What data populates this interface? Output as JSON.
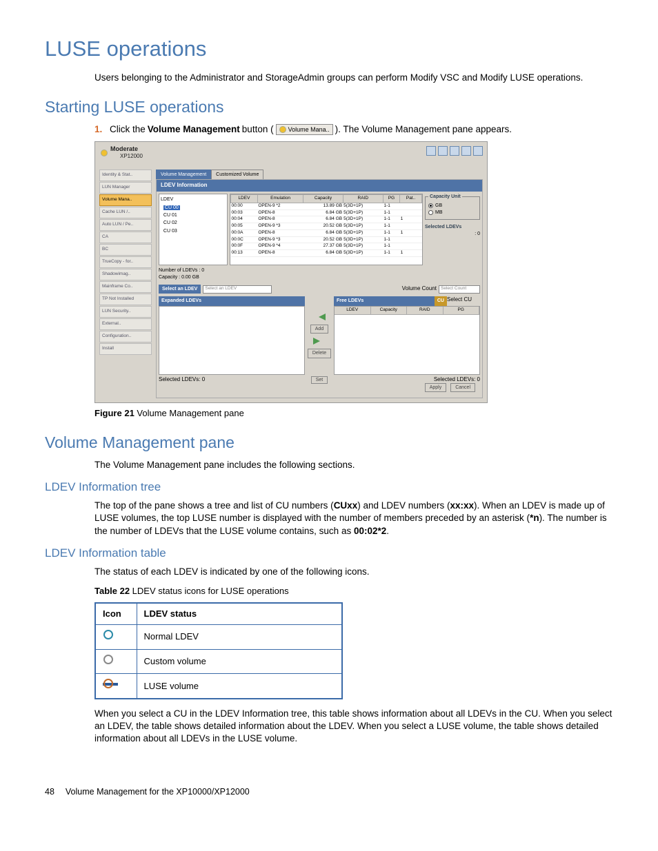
{
  "headings": {
    "h1": "LUSE operations",
    "h2_start": "Starting LUSE operations",
    "h2_vmp": "Volume Management pane",
    "h3_tree": "LDEV Information tree",
    "h3_table": "LDEV Information table"
  },
  "paras": {
    "intro": "Users belonging to the Administrator and StorageAdmin groups can perform Modify VSC and Modify LUSE operations.",
    "vmp_intro": "The Volume Management pane includes the following sections.",
    "tree_p_a": "The top of the pane shows a tree and list of CU numbers (",
    "tree_p_b": ") and LDEV numbers (",
    "tree_p_c": "). When an LDEV is made up of LUSE volumes, the top LUSE number is displayed with the number of members preceded by an asterisk (",
    "tree_p_d": "). The number is the number of LDEVs that the LUSE volume contains, such as ",
    "tree_bold_cu": "CUxx",
    "tree_bold_ldev": "xx:xx",
    "tree_bold_n": "*n",
    "tree_bold_ex": "00:02*2",
    "table_p": "The status of each LDEV is indicated by one of the following icons.",
    "cu_select": "When you select a CU in the LDEV Information tree, this table shows information about all LDEVs in the CU. When you select an LDEV, the table shows detailed information about the LDEV. When you select a LUSE volume, the table shows detailed information about all LDEVs in the LUSE volume."
  },
  "step1": {
    "num": "1.",
    "a": "Click the ",
    "b": "Volume Management",
    "c": " button ( ",
    "btn": "Volume Mana..",
    "d": " ). The Volume Management pane appears."
  },
  "fig21": {
    "label": "Figure 21",
    "text": " Volume Management pane"
  },
  "tbl22": {
    "label": "Table 22",
    "text": "   LDEV status icons for LUSE operations"
  },
  "status_table": {
    "h_icon": "Icon",
    "h_status": "LDEV status",
    "rows": [
      {
        "status": "Normal LDEV"
      },
      {
        "status": "Custom volume"
      },
      {
        "status": "LUSE volume"
      }
    ]
  },
  "footer": {
    "page": "48",
    "title": "Volume Management for the XP10000/XP12000"
  },
  "screenshot": {
    "moderate": "Moderate",
    "model": "XP12000",
    "tabs": {
      "vm": "Volume Management",
      "cv": "Customized Volume"
    },
    "banner": "LDEV Information",
    "sidebar": [
      "Identity & Stat..",
      "LUN Manager",
      "Volume Mana..",
      "Cache LUN /..",
      "Auto LUN / Pe..",
      "CA",
      "BC",
      "TrueCopy - for..",
      "Shadowimag..",
      "Mainframe Co..",
      "TP Not Installed",
      "LUN Security..",
      "External..",
      "Configuration..",
      "Install"
    ],
    "tree": {
      "root": "LDEV",
      "sel": "CU 00",
      "items": [
        "CU 01",
        "CU 02",
        "CU 03"
      ]
    },
    "table": {
      "headers": [
        "LDEV",
        "Emulation",
        "Capacity",
        "RAID",
        "PG",
        "Pat.."
      ],
      "rows": [
        [
          "00:00",
          "OPEN-9 *2",
          "13.89 GB",
          "5(3D+1P)",
          "1-1",
          ""
        ],
        [
          "00:03",
          "OPEN-8",
          "6.84 GB",
          "5(3D+1P)",
          "1-1",
          ""
        ],
        [
          "00:04",
          "OPEN-8",
          "6.84 GB",
          "5(3D+1P)",
          "1-1",
          "1"
        ],
        [
          "00:05",
          "OPEN-9 *3",
          "20.52 GB",
          "5(3D+1P)",
          "1-1",
          ""
        ],
        [
          "00:0A",
          "OPEN-8",
          "6.84 GB",
          "5(3D+1P)",
          "1-1",
          "1"
        ],
        [
          "00:0C",
          "OPEN-9 *3",
          "20.52 GB",
          "5(3D+1P)",
          "1-1",
          ""
        ],
        [
          "00:0F",
          "OPEN-9 *4",
          "27.37 GB",
          "5(3D+1P)",
          "1-1",
          ""
        ],
        [
          "00:13",
          "OPEN-8",
          "6.84 GB",
          "5(3D+1P)",
          "1-1",
          "1"
        ]
      ]
    },
    "capunit": {
      "legend": "Capacity Unit",
      "gb": "GB",
      "mb": "MB"
    },
    "selected_ldevs_label": "Selected LDEVs",
    "selected_ldevs_val": ": 0",
    "num_ldevs": "Number of LDEVs   : 0",
    "capacity": "Capacity               : 0.00 GB",
    "select_ldev": "Select an LDEV",
    "select_ldev_dd": "Select an LDEV",
    "vol_count": "Volume Count",
    "vol_count_dd": "Select Count",
    "expanded": "Expanded LDEVs",
    "free": "Free LDEVs",
    "free_headers": [
      "LDEV",
      "Capacity",
      "RAID",
      "PG"
    ],
    "cu_label": "CU",
    "cu_dd": "Select CU",
    "add": "Add",
    "delete": "Delete",
    "set": "Set",
    "sel_left": "Selected LDEVs: 0",
    "sel_right": "Selected LDEVs: 0",
    "apply": "Apply",
    "cancel": "Cancel"
  }
}
